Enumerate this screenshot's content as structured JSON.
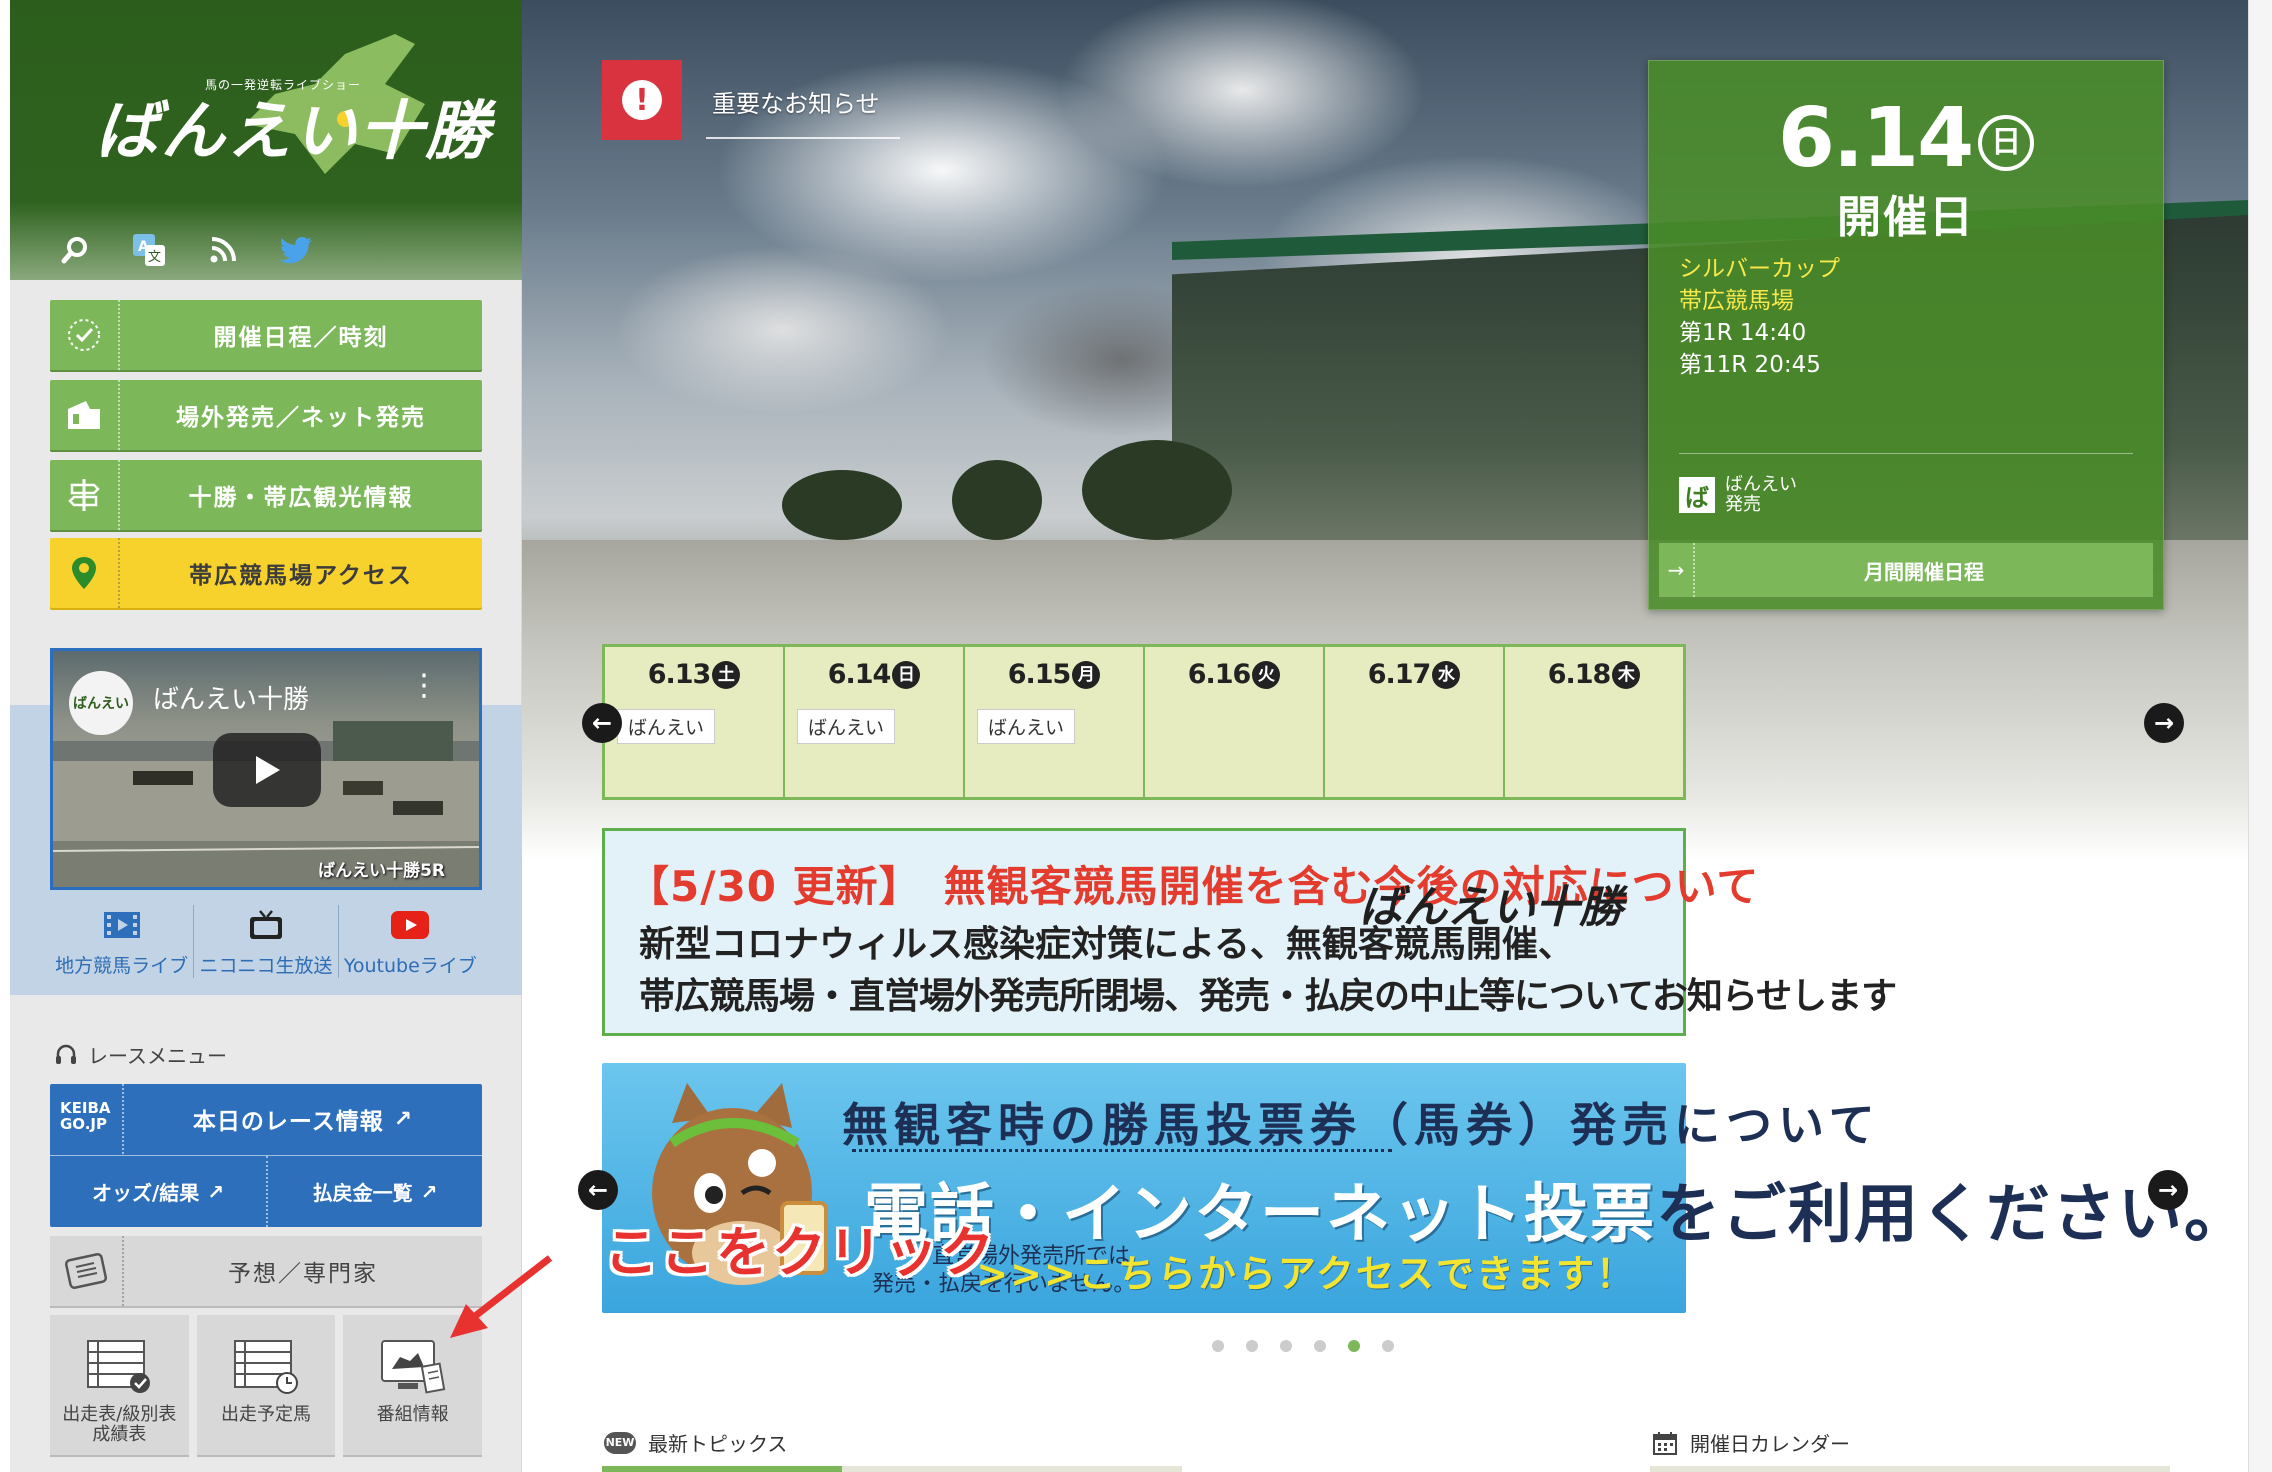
{
  "logo": {
    "subtitle": "馬の一発逆転ライブショー",
    "title": "ばんえい十勝"
  },
  "header_icons": [
    "search-icon",
    "translate-icon",
    "rss-icon",
    "twitter-icon"
  ],
  "nav": [
    {
      "label": "開催日程／時刻",
      "icon": "clock-icon"
    },
    {
      "label": "場外発売／ネット発売",
      "icon": "ticket-icon"
    },
    {
      "label": "十勝・帯広観光情報",
      "icon": "signpost-icon"
    },
    {
      "label": "帯広競馬場アクセス",
      "icon": "map-pin-icon"
    }
  ],
  "video": {
    "title": "ばんえい十勝",
    "logo_text": "ばんえい",
    "footer": "ばんえい十勝5R"
  },
  "live_links": [
    {
      "label": "地方競馬ライブ",
      "icon": "film-icon"
    },
    {
      "label": "ニコニコ生放送",
      "icon": "tv-icon"
    },
    {
      "label": "Youtubeライブ",
      "icon": "youtube-icon"
    }
  ],
  "race_menu": {
    "title": "レースメニュー",
    "keiba": "KEIBA GO.JP",
    "today": "本日のレース情報",
    "odds": "オッズ/結果",
    "payout": "払戻金一覧",
    "expert": "予想／専門家",
    "tiles": [
      {
        "label1": "出走表/級別表",
        "label2": "成績表"
      },
      {
        "label1": "出走予定馬",
        "label2": ""
      },
      {
        "label1": "番組情報",
        "label2": ""
      }
    ]
  },
  "alert": {
    "text": "重要なお知らせ"
  },
  "date_card": {
    "date": "6.14",
    "weekday": "日",
    "label": "開催日",
    "event": "シルバーカップ",
    "venue": "帯広競馬場",
    "first_race": "第1R 14:40",
    "last_race": "第11R 20:45",
    "sale_badge": "ば",
    "sale_line1": "ばんえい",
    "sale_line2": "発売",
    "monthly": "月間開催日程"
  },
  "week": [
    {
      "date": "6.13",
      "day": "土",
      "tag": "ばんえい"
    },
    {
      "date": "6.14",
      "day": "日",
      "tag": "ばんえい"
    },
    {
      "date": "6.15",
      "day": "月",
      "tag": "ばんえい"
    },
    {
      "date": "6.16",
      "day": "火",
      "tag": ""
    },
    {
      "date": "6.17",
      "day": "水",
      "tag": ""
    },
    {
      "date": "6.18",
      "day": "木",
      "tag": ""
    }
  ],
  "banner1": {
    "headline": "【5/30 更新】　無観客競馬開催を含む今後の対応について",
    "line1": "新型コロナウィルス感染症対策による、無観客競馬開催、",
    "line2": "帯広競馬場・直営場外発売所閉場、発売・払戻の中止等についてお知らせします",
    "logo": "ばんえい十勝"
  },
  "banner2": {
    "headline": "無観客時の勝馬投票券（馬券）発売について",
    "big_white": "電話・インターネット投票",
    "big_dark": "をご利用ください。",
    "note1": "直営場外発売所では",
    "note2": "発売・払戻を行いません。",
    "access": ">>>こちらからアクセスできます！"
  },
  "callout": "ここをクリック",
  "carousel": {
    "count": 6,
    "active": 5
  },
  "sections": {
    "topics": "最新トピックス",
    "calendar": "開催日カレンダー",
    "new_badge": "NEW"
  },
  "colors": {
    "green_dark": "#2c5d1c",
    "green": "#7cb85a",
    "yellow": "#f7d22c",
    "blue": "#2e6fbc",
    "red": "#e8322f"
  }
}
